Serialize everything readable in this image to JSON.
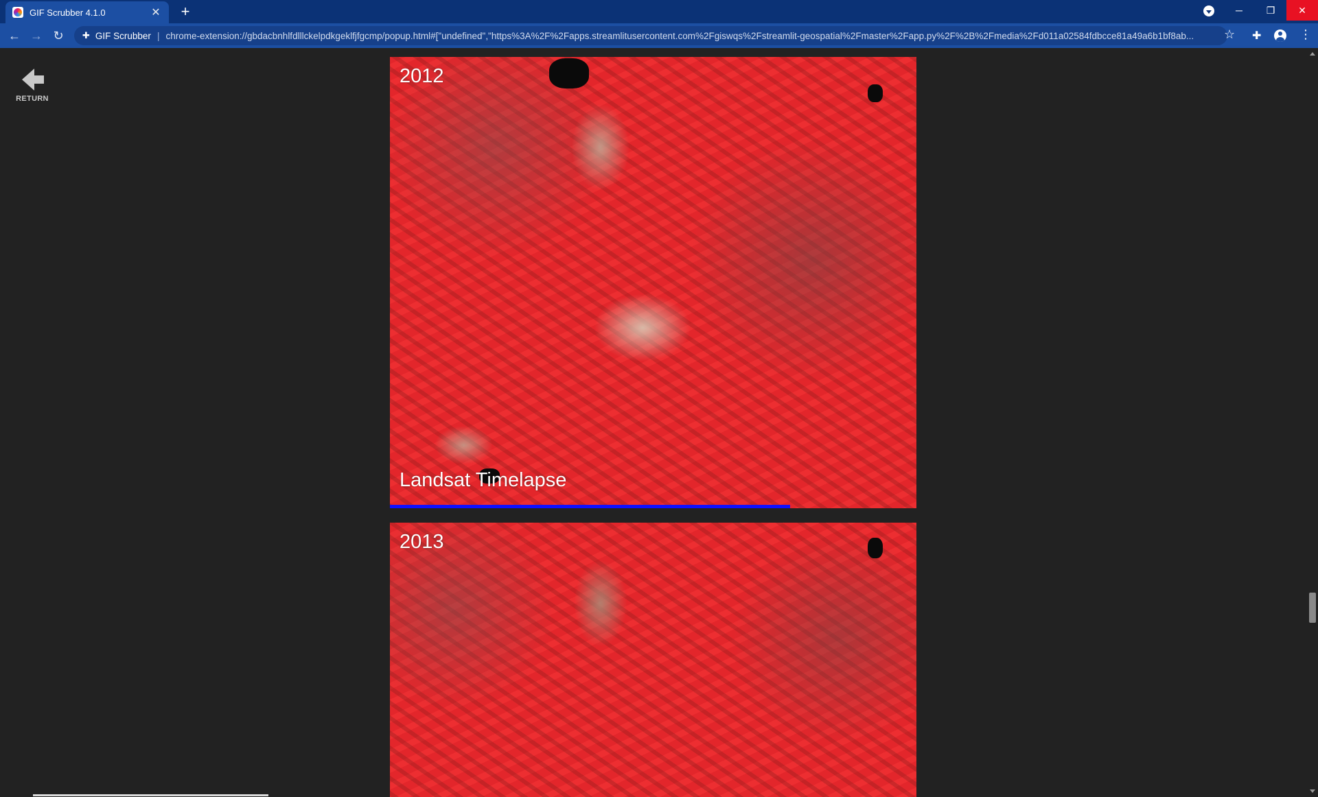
{
  "browser": {
    "tab_title": "GIF Scrubber 4.1.0",
    "tab_close": "✕",
    "new_tab": "+",
    "site_name": "GIF Scrubber",
    "url": "chrome-extension://gbdacbnhlfdlllckelpdkgeklfjfgcmp/popup.html#[\"undefined\",\"https%3A%2F%2Fapps.streamlitusercontent.com%2Fgiswqs%2Fstreamlit-geospatial%2Fmaster%2Fapp.py%2F%2B%2Fmedia%2Fd011a02584fdbcce81a49a6b1bf8ab...",
    "window_controls": {
      "minimize": "─",
      "restore": "❐",
      "close": "✕"
    }
  },
  "page": {
    "return_label": "RETURN",
    "frames": [
      {
        "year": "2012",
        "caption": "Landsat Timelapse",
        "progress": 0.76
      },
      {
        "year": "2013"
      }
    ]
  },
  "colors": {
    "titlebar": "#0b3276",
    "toolbar": "#1c4fa3",
    "page_background": "#222222",
    "progress_bar": "#1010ff",
    "false_color_red": "#e3262b"
  }
}
